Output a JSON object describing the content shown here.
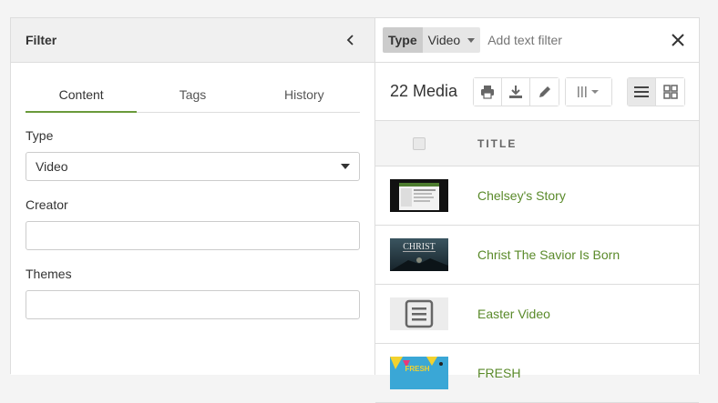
{
  "filter": {
    "title": "Filter",
    "tabs": [
      {
        "label": "Content"
      },
      {
        "label": "Tags"
      },
      {
        "label": "History"
      }
    ],
    "fields": {
      "type_label": "Type",
      "type_value": "Video",
      "creator_label": "Creator",
      "creator_value": "",
      "themes_label": "Themes",
      "themes_value": ""
    }
  },
  "search": {
    "chip_key": "Type",
    "chip_value": "Video",
    "placeholder": "Add text filter"
  },
  "toolbar": {
    "count": "22 Media"
  },
  "table": {
    "column_title": "TITLE",
    "rows": [
      {
        "title": "Chelsey's Story"
      },
      {
        "title": "Christ The Savior Is Born"
      },
      {
        "title": "Easter Video"
      },
      {
        "title": "FRESH"
      }
    ]
  },
  "thumb_text": {
    "christ": "CHRIST",
    "fresh": "FRESH"
  },
  "colors": {
    "accent": "#6a9a3a",
    "link": "#5a8a2a"
  }
}
